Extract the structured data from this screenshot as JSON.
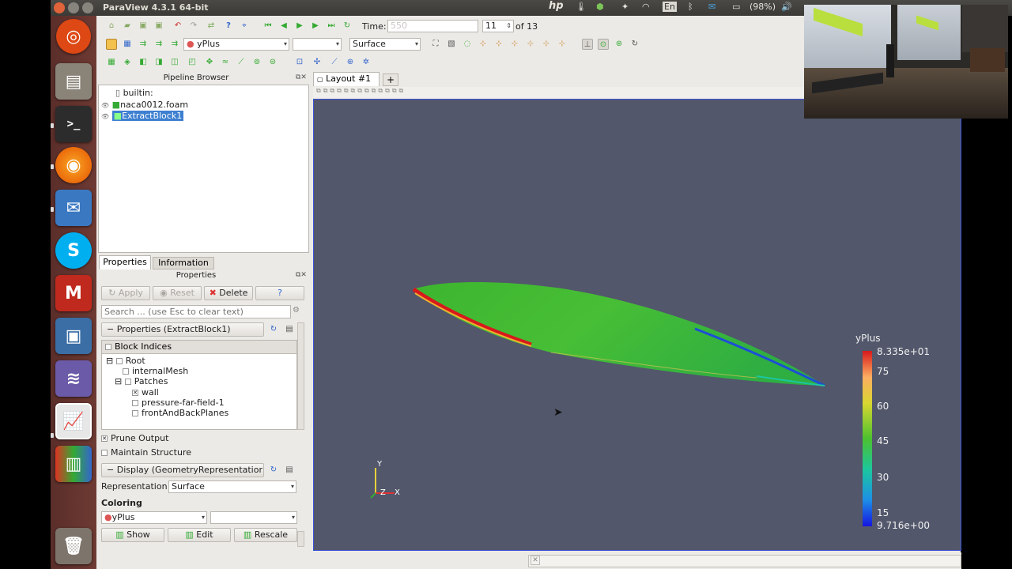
{
  "window": {
    "title": "ParaView 4.3.1 64-bit"
  },
  "tray": {
    "keyboard": "En",
    "battery": "(98%)"
  },
  "toolbar": {
    "time_label": "Time:",
    "time_value": "550",
    "timestep_value": "11",
    "timestep_total": "of 13",
    "color_array": "yPlus",
    "representation": "Surface"
  },
  "pipeline": {
    "title": "Pipeline Browser",
    "items": [
      {
        "label": "builtin:"
      },
      {
        "label": "naca0012.foam"
      },
      {
        "label": "ExtractBlock1"
      }
    ]
  },
  "tabs": {
    "properties": "Properties",
    "information": "Information"
  },
  "properties": {
    "title": "Properties",
    "apply": "Apply",
    "reset": "Reset",
    "delete": "Delete",
    "help": "?",
    "search_placeholder": "Search ... (use Esc to clear text)",
    "section_properties": "Properties (ExtractBlock1)",
    "block_indices": "Block Indices",
    "tree": {
      "root": "Root",
      "internal_mesh": "internalMesh",
      "patches": "Patches",
      "wall": "wall",
      "pressure_far_field": "pressure-far-field-1",
      "front_and_back": "frontAndBackPlanes"
    },
    "prune_output": "Prune Output",
    "maintain_structure": "Maintain Structure",
    "section_display": "Display (GeometryRepresentatior",
    "representation_label": "Representation",
    "representation_value": "Surface",
    "coloring_label": "Coloring",
    "coloring_value": "yPlus",
    "show": "Show",
    "edit": "Edit",
    "rescale": "Rescale"
  },
  "layout_tab": {
    "label": "Layout #1",
    "add": "+"
  },
  "colorbar": {
    "title": "yPlus",
    "max": "8.335e+01",
    "ticks": [
      "75",
      "60",
      "45",
      "30",
      "15"
    ],
    "min": "9.716e+00"
  },
  "axes": {
    "y": "Y",
    "z": "Z",
    "x": "X"
  },
  "colors": {
    "viewport_bg": "#52576b",
    "surface_green": "#3fb92f",
    "leading_edge": "#d7191c",
    "trailing_edge": "#1d4fd6"
  }
}
